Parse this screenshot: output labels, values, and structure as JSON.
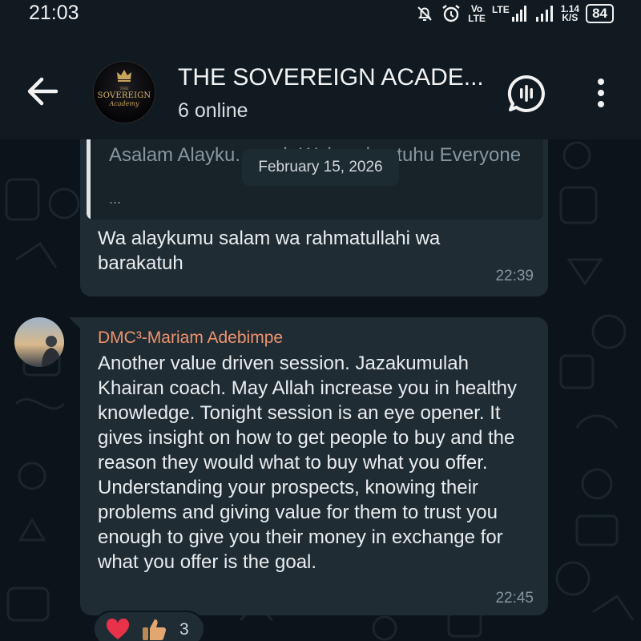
{
  "status_bar": {
    "time": "21:03",
    "vo_label": "Vo",
    "lte_label": "LTE",
    "lte2_label": "LTE",
    "speed_value": "1.14",
    "speed_unit": "K/S",
    "battery": "84"
  },
  "header": {
    "title": "THE SOVEREIGN ACADE...",
    "subtitle": "6 online",
    "avatar_top": "THE",
    "avatar_main": "SOVEREIGN",
    "avatar_sub": "Academy"
  },
  "date_chip": "February 15, 2026",
  "messages": [
    {
      "quote": {
        "text": "Asalam Alayku... ...ah Wabarokaatuhu Everyone",
        "more": "..."
      },
      "text": "Wa alaykumu salam wa rahmatullahi wa barakatuh",
      "time": "22:39"
    },
    {
      "sender": "DMC³-Mariam Adebimpe",
      "text": "Another value driven session. Jazakumulah Khairan coach. May Allah increase you in healthy knowledge. Tonight session is an eye opener. It gives insight on how to get people to buy and the reason they would what to buy what you offer. Understanding your prospects, knowing their problems and giving value for them to trust you enough to give you their money in exchange for what you offer is the goal.",
      "time": "22:45",
      "reactions": {
        "emojis": [
          "heart",
          "thumbs-up"
        ],
        "count": "3"
      }
    }
  ],
  "colors": {
    "background": "#0b141a",
    "bubble": "#1f2c34",
    "header": "#101a20",
    "sender_name": "#f0936e",
    "meta_text": "#8696a0"
  }
}
